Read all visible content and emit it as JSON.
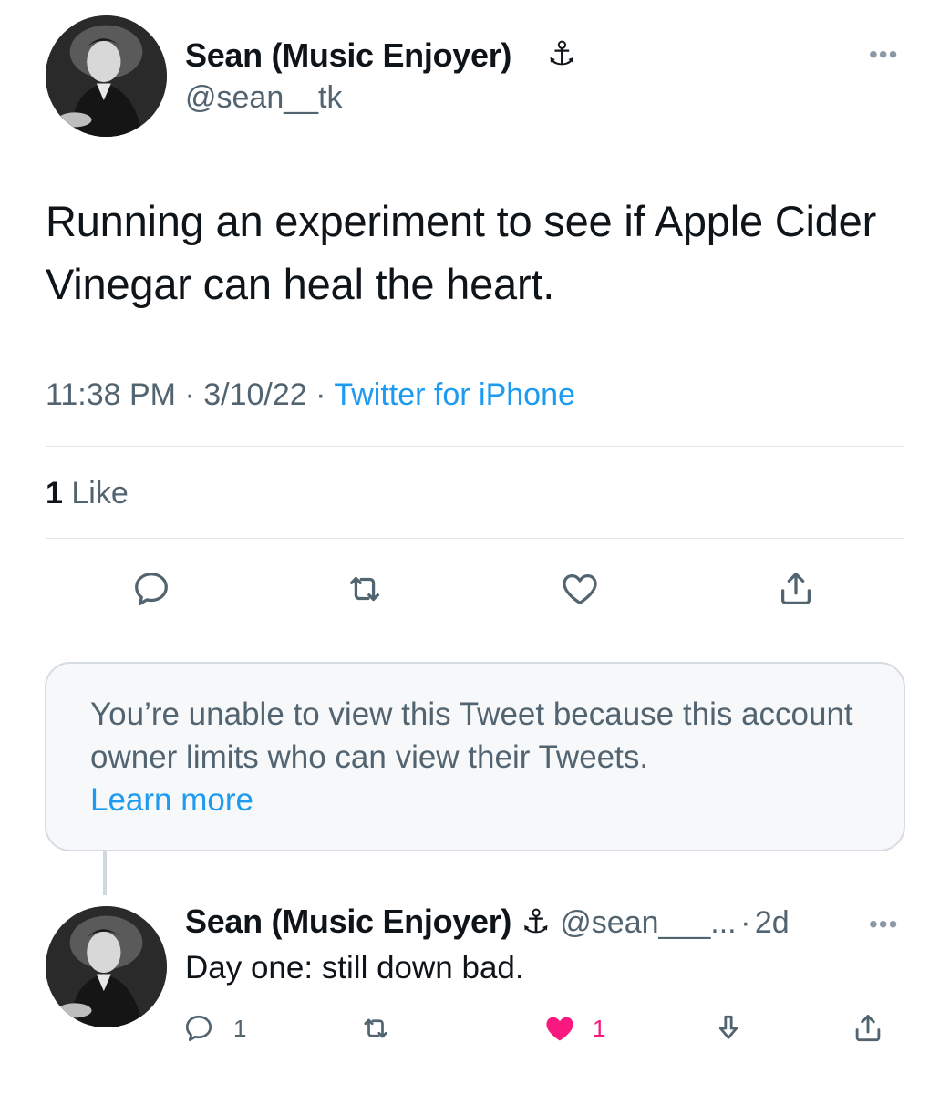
{
  "tweet": {
    "author_name": "Sean (Music Enjoyer)",
    "anchor_emoji": "⚓",
    "handle": "@sean__tk",
    "more_label": "•••",
    "text": "Running an experiment to see if Apple Cider Vinegar can heal the heart.",
    "time": "11:38 PM",
    "date": "3/10/22",
    "separator": "·",
    "source": "Twitter for iPhone",
    "like_count": "1",
    "like_label": "Like",
    "actions": [
      "reply-icon",
      "retweet-icon",
      "like-icon",
      "share-icon"
    ]
  },
  "notice": {
    "text": "You’re unable to view this Tweet because this account owner limits who can view their Tweets.",
    "link": "Learn more"
  },
  "reply": {
    "author_name": "Sean (Music Enjoyer)",
    "anchor_emoji": "⚓",
    "handle": "@sean___...",
    "separator": "·",
    "age": "2d",
    "more_label": "•••",
    "text": "Day one: still down bad.",
    "reply_count": "1",
    "like_count": "1",
    "liked": true,
    "like_color": "#f91880"
  },
  "colors": {
    "link": "#1d9bf0",
    "secondary_text": "#536471",
    "primary_text": "#0f1419"
  }
}
